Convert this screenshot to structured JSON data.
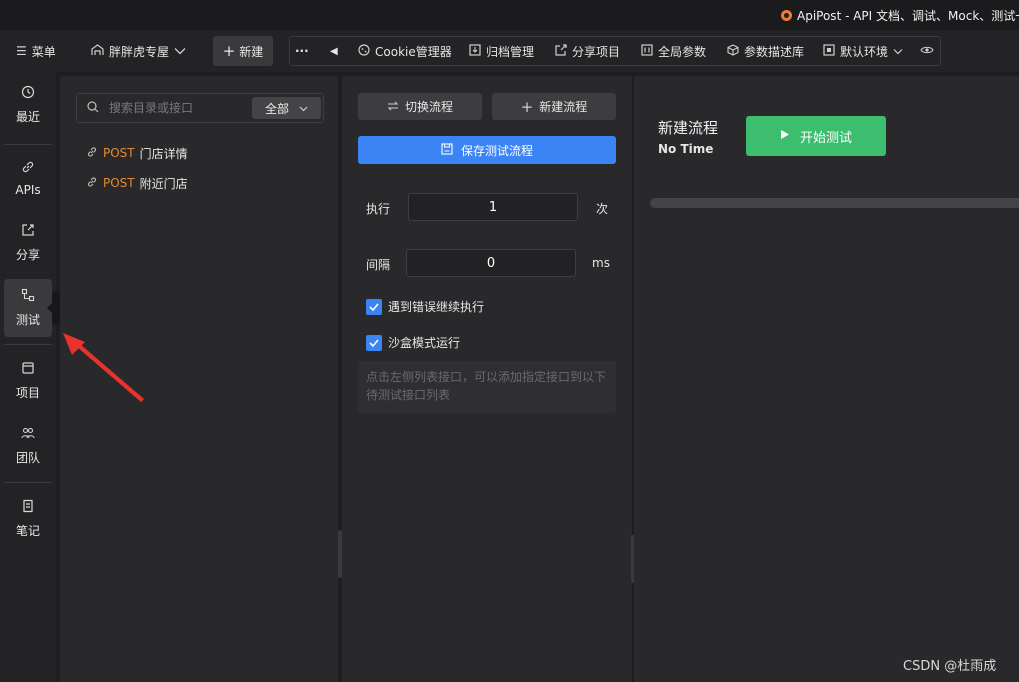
{
  "window": {
    "title": "ApiPost - API 文档、调试、Mock、测试一"
  },
  "toolbar": {
    "menu_label": "菜单",
    "workspace_label": "胖胖虎专屋",
    "new_label": "新建",
    "more_label": "···",
    "cookie_label": "Cookie管理器",
    "archive_label": "归档管理",
    "share_label": "分享项目",
    "global_params_label": "全局参数",
    "param_desc_label": "参数描述库",
    "env_label": "默认环境"
  },
  "sidebar": {
    "items": [
      {
        "label": "最近",
        "icon": "history-icon"
      },
      {
        "label": "APIs",
        "icon": "link-icon"
      },
      {
        "label": "分享",
        "icon": "share-icon"
      },
      {
        "label": "测试",
        "icon": "test-icon"
      },
      {
        "label": "项目",
        "icon": "project-icon"
      },
      {
        "label": "团队",
        "icon": "team-icon"
      },
      {
        "label": "笔记",
        "icon": "note-icon"
      }
    ],
    "active": "测试"
  },
  "tooltip": {
    "text": "测试"
  },
  "api_list": {
    "search_placeholder": "搜索目录或接口",
    "scope_label": "全部",
    "items": [
      {
        "method": "POST",
        "name": "门店详情"
      },
      {
        "method": "POST",
        "name": "附近门店"
      }
    ]
  },
  "flow_config": {
    "switch_label": "切换流程",
    "new_flow_label": "新建流程",
    "save_label": "保存测试流程",
    "execute_label": "执行",
    "execute_value": "1",
    "execute_unit": "次",
    "interval_label": "间隔",
    "interval_value": "0",
    "interval_unit": "ms",
    "continue_on_error_label": "遇到错误继续执行",
    "continue_on_error_checked": true,
    "sandbox_label": "沙盒模式运行",
    "sandbox_checked": true,
    "hint_text": "点击左侧列表接口，可以添加指定接口到以下待测试接口列表"
  },
  "flow_result": {
    "title": "新建流程",
    "time": "No Time",
    "start_label": "开始测试",
    "progress": 0
  },
  "watermark": "CSDN @杜雨成",
  "colors": {
    "accent_blue": "#3a84f6",
    "start_green": "#3dbd6e",
    "method_orange": "#e8892f",
    "annotation_red": "#e8322b"
  }
}
